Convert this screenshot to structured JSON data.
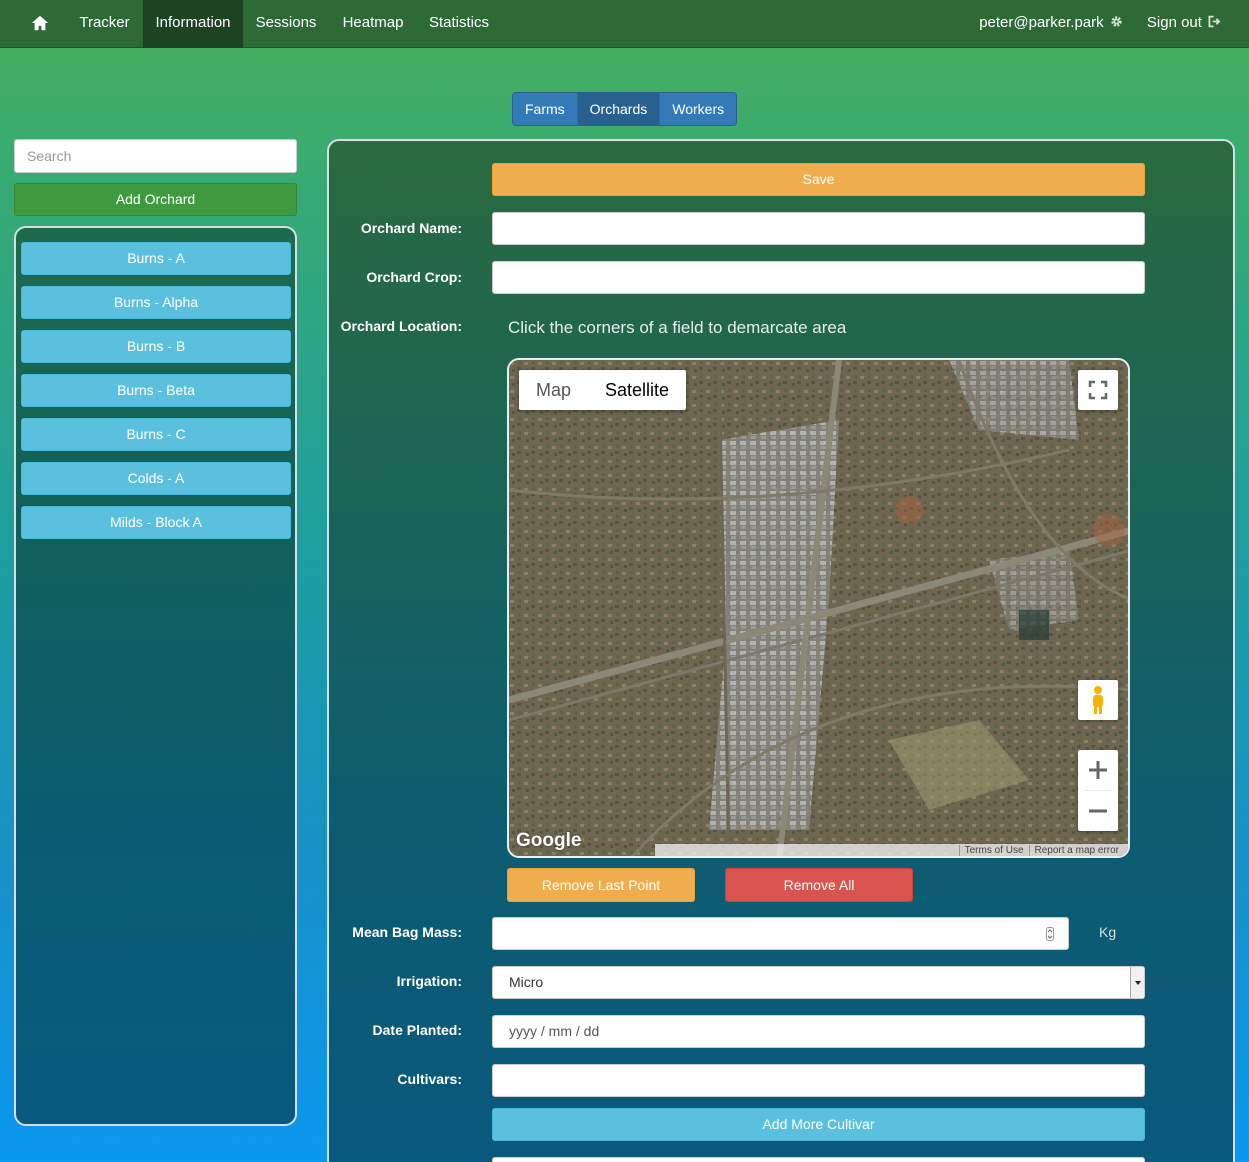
{
  "nav": {
    "items": [
      "Tracker",
      "Information",
      "Sessions",
      "Heatmap",
      "Statistics"
    ],
    "active": "Information",
    "user": "peter@parker.park",
    "signout": "Sign out"
  },
  "tabs": {
    "items": [
      "Farms",
      "Orchards",
      "Workers"
    ],
    "active": "Orchards"
  },
  "sidebar": {
    "search_placeholder": "Search",
    "add_label": "Add Orchard",
    "items": [
      {
        "label": "Burns - A"
      },
      {
        "label": "Burns - Alpha"
      },
      {
        "label": "Burns - B"
      },
      {
        "label": "Burns - Beta"
      },
      {
        "label": "Burns - C"
      },
      {
        "label": "Colds - A"
      },
      {
        "label": "Milds - Block A"
      }
    ]
  },
  "form": {
    "save_label": "Save",
    "name_label": "Orchard Name:",
    "crop_label": "Orchard Crop:",
    "location_label": "Orchard Location:",
    "location_hint": "Click the corners of a field to demarcate area",
    "map": {
      "type_map": "Map",
      "type_satellite": "Satellite",
      "selected_type": "Satellite",
      "logo": "Google",
      "terms": "Terms of Use",
      "report": "Report a map error"
    },
    "remove_last_label": "Remove Last Point",
    "remove_all_label": "Remove All",
    "bag_mass_label": "Mean Bag Mass:",
    "bag_mass_unit": "Kg",
    "irrigation_label": "Irrigation:",
    "irrigation_value": "Micro",
    "date_label": "Date Planted:",
    "date_placeholder": "yyyy / mm / dd",
    "cultivars_label": "Cultivars:",
    "add_cultivar_label": "Add More Cultivar"
  },
  "colors": {
    "navbar": "#2e6a36",
    "save": "#f0ad4e",
    "danger": "#d9534f",
    "info": "#5bc0de",
    "success": "#3f9a3f",
    "primary": "#337ab7"
  }
}
